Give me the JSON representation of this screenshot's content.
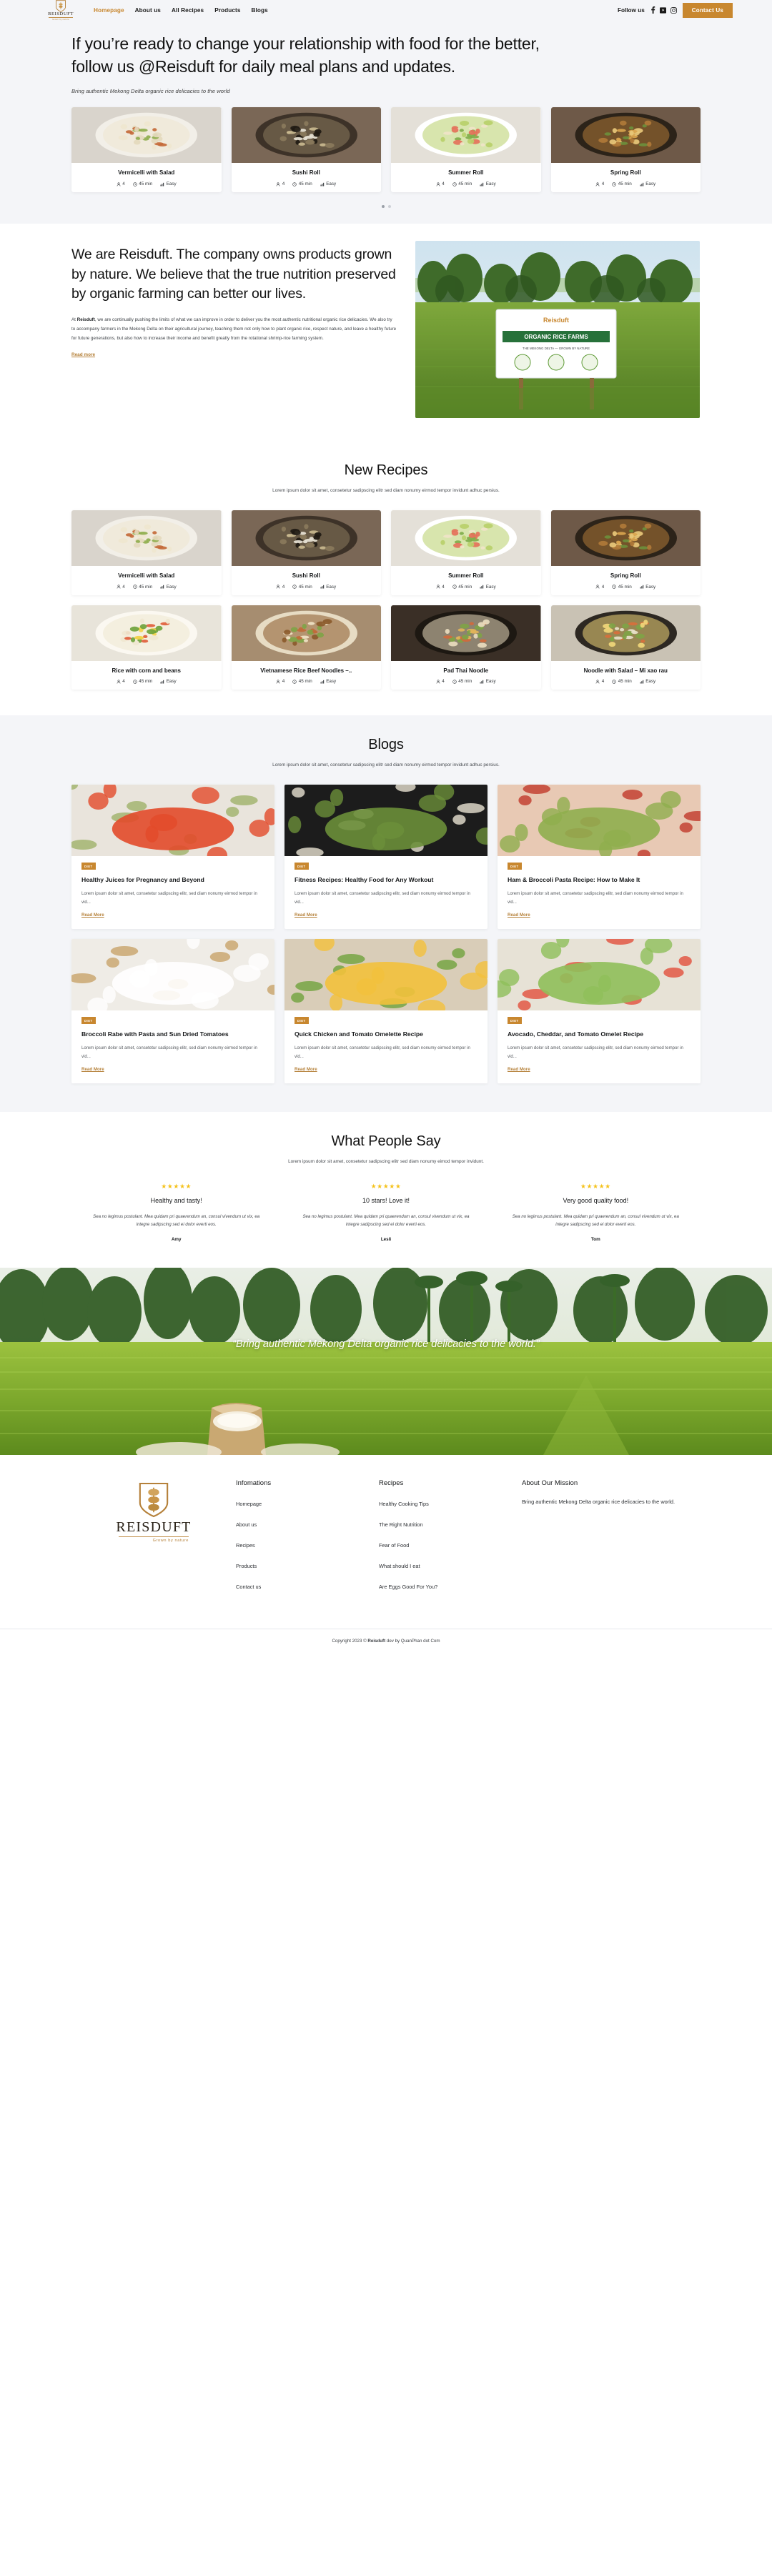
{
  "header": {
    "brand": {
      "word": "REISDUFT",
      "tagline": "Grown by nature"
    },
    "nav": [
      {
        "label": "Homepage",
        "active": true
      },
      {
        "label": "About us",
        "active": false
      },
      {
        "label": "All Recipes",
        "active": false
      },
      {
        "label": "Products",
        "active": false
      },
      {
        "label": "Blogs",
        "active": false
      }
    ],
    "follow_label": "Follow us",
    "social": [
      "facebook-icon",
      "youtube-icon",
      "instagram-icon"
    ],
    "contact_label": "Contact Us"
  },
  "hero": {
    "headline": "If you’re ready to change your relationship with food for the better, follow us @Reisduft for daily meal plans and updates.",
    "subline": "Bring authentic Mekong Delta organic rice delicacies to the world"
  },
  "hero_cards": [
    {
      "title": "Vermicelli with Salad",
      "servings": "4",
      "time": "45 min",
      "level": "Easy"
    },
    {
      "title": "Sushi Roll",
      "servings": "4",
      "time": "45 min",
      "level": "Easy"
    },
    {
      "title": "Summer Roll",
      "servings": "4",
      "time": "45 min",
      "level": "Easy"
    },
    {
      "title": "Spring Roll",
      "servings": "4",
      "time": "45 min",
      "level": "Easy"
    }
  ],
  "about": {
    "heading": "We are Reisduft. The company owns products grown by nature. We believe that the true nutrition preserved by organic farming can better our lives.",
    "body_lead": "At ",
    "body_bold": "Reisduft",
    "body_rest": ", we are continually pushing the limits of what we can improve in order to deliver you the most authentic nutritional organic rice delicacies. We also try to accompany farmers in the Mekong Delta on their agricultural journey, teaching them not only how to plant organic rice, respect nature, and leave a healthy future for future generations, but also how to increase their income and benefit greatly from the rotational shrimp-rice farming system.",
    "readmore": "Read more",
    "sign_title": "ORGANIC RICE FARMS",
    "sign_sub": "THE MEKONG DELTA — GROWN BY NATURE"
  },
  "new_recipes": {
    "title": "New Recipes",
    "subtitle": "Lorem ipsum dolor sit amet, consetetur sadipscing elitr sed diam nonumy eirmod tempor invidunt adhuc persius.",
    "row1": [
      {
        "title": "Vermicelli with Salad",
        "servings": "4",
        "time": "45 min",
        "level": "Easy"
      },
      {
        "title": "Sushi Roll",
        "servings": "4",
        "time": "45 min",
        "level": "Easy"
      },
      {
        "title": "Summer Roll",
        "servings": "4",
        "time": "45 min",
        "level": "Easy"
      },
      {
        "title": "Spring Roll",
        "servings": "4",
        "time": "45 min",
        "level": "Easy"
      }
    ],
    "row2": [
      {
        "title": "Rice with corn and beans",
        "servings": "4",
        "time": "45 min",
        "level": "Easy"
      },
      {
        "title": "Vietnamese Rice Beef Noodles –..",
        "servings": "4",
        "time": "45 min",
        "level": "Easy"
      },
      {
        "title": "Pad Thai Noodle",
        "servings": "4",
        "time": "45 min",
        "level": "Easy"
      },
      {
        "title": "Noodle with Salad – Mi xao rau",
        "servings": "4",
        "time": "45 min",
        "level": "Easy"
      }
    ]
  },
  "blogs": {
    "title": "Blogs",
    "subtitle": "Lorem ipsum dolor sit amet, consetetur sadipscing elitr sed diam nonumy eirmod tempor invidunt adhuc persius.",
    "badge": "DIET",
    "excerpt": "Lorem ipsum dolor sit amet, consetetur sadipscing elitr, sed diam nonumy eirmod tempor in vid...",
    "readmore": "Read More",
    "row1": [
      {
        "title": "Healthy Juices for Pregnancy and Beyond"
      },
      {
        "title": "Fitness Recipes: Healthy Food for Any Workout"
      },
      {
        "title": "Ham & Broccoli Pasta Recipe: How to Make It"
      }
    ],
    "row2": [
      {
        "title": "Broccoli Rabe with Pasta and Sun Dried Tomatoes"
      },
      {
        "title": "Quick Chicken and Tomato Omelette Recipe"
      },
      {
        "title": "Avocado, Cheddar, and Tomato Omelet Recipe"
      }
    ]
  },
  "testimonials": {
    "title": "What People Say",
    "subtitle": "Lorem ipsum dolor sit amet, consetetur sadipscing elitr sed diam nonumy eimod tempor invidunt.",
    "stars": "★★★★★",
    "items": [
      {
        "title": "Healthy and tasty!",
        "quote": "Sea no legimus postulant. Mea quidam pri quaerendum an, consul vivendum ut vix, ea integre sadipscing sed ei dolor everti eos.",
        "name": "Amy"
      },
      {
        "title": "10 stars! Love it!",
        "quote": "Sea no legimus postulant. Mea quidam pri quaerendum an, consul vivendum ut vix, ea integre sadipscing sed ei dolor everti eos.",
        "name": "Lesli"
      },
      {
        "title": "Very good quality food!",
        "quote": "Sea no legimus postulant. Mea quidam pri quaerendum an, consul vivendum ut vix, ea integre sadipscing sed ei dolor everti eos.",
        "name": "Tom"
      }
    ]
  },
  "banner": {
    "quote": "“Bring authentic Mekong Delta organic rice delicacies to the world.”"
  },
  "footer": {
    "brand": {
      "word": "REISDUFT",
      "tagline": "Grown by nature"
    },
    "columns": [
      {
        "heading": "Infomations",
        "links": [
          "Homepage",
          "About us",
          "Recipes",
          "Products",
          "Contact us"
        ]
      },
      {
        "heading": "Recipes",
        "links": [
          "Healthy Cooking Tips",
          "The Right Nutrition",
          "Fear of Food",
          "What should I eat",
          "Are Eggs Good For You?"
        ]
      }
    ],
    "mission_heading": "About Our Mission",
    "mission_text": "Bring authentic Mekong Delta organic rice delicacies to the world.",
    "copyright_pre": "Copyright 2023 © ",
    "copyright_brand": "Reisduft",
    "copyright_post": " dev by QuanPhan dot Com"
  },
  "colors": {
    "accent": "#c8872f",
    "accent_link": "#b5813a",
    "page_bg": "#f4f5f8",
    "star": "#f5c21b"
  }
}
